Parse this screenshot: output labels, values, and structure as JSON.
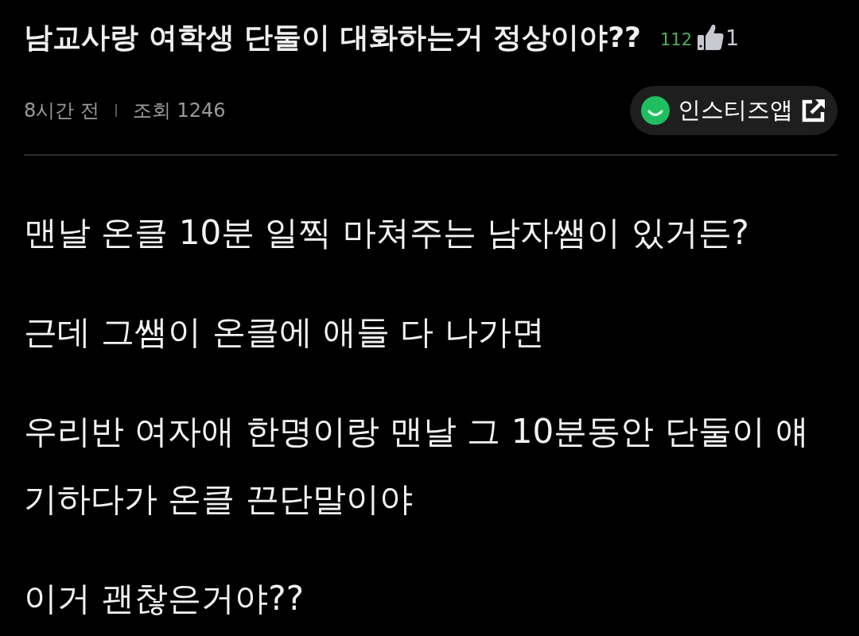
{
  "post": {
    "title": "남교사랑 여학생 단둘이 대화하는거 정상이야??",
    "comment_count": "112",
    "likes": "1"
  },
  "meta": {
    "time": "8시간 전",
    "views": "조회 1246"
  },
  "app_button": {
    "label": "인스티즈앱"
  },
  "body": {
    "paragraphs": [
      "맨날 온클 10분 일찍 마쳐주는 남자쌤이 있거든?",
      "근데 그쌤이 온클에 애들 다 나가면",
      "우리반 여자애 한명이랑 맨날 그 10분동안 단둘이 얘기하다가 온클 끈단말이야",
      "이거 괜찮은거야??"
    ]
  }
}
